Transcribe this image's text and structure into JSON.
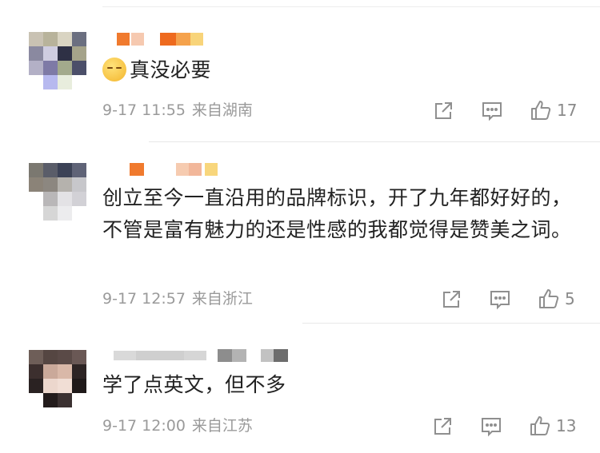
{
  "comments": [
    {
      "text": "真没必要",
      "emoji": "sad-sweat-emoji",
      "timestamp": "9-17 11:55",
      "location": "来自湖南",
      "likes": "17"
    },
    {
      "text": "创立至今一直沿用的品牌标识，开了九年都好好的，不管是富有魅力的还是性感的我都觉得是赞美之词。",
      "timestamp": "9-17 12:57",
      "location": "来自浙江",
      "likes": "5"
    },
    {
      "text": "学了点英文，但不多",
      "timestamp": "9-17 12:00",
      "location": "来自江苏",
      "likes": "13"
    }
  ],
  "icons": {
    "share": "share-icon",
    "comment": "comment-icon",
    "like": "thumbs-up-icon"
  },
  "colors": {
    "meta_gray": "#9a9a9a",
    "icon_gray": "#8f8f8f",
    "divider": "#e8e8e8",
    "text": "#222222"
  }
}
